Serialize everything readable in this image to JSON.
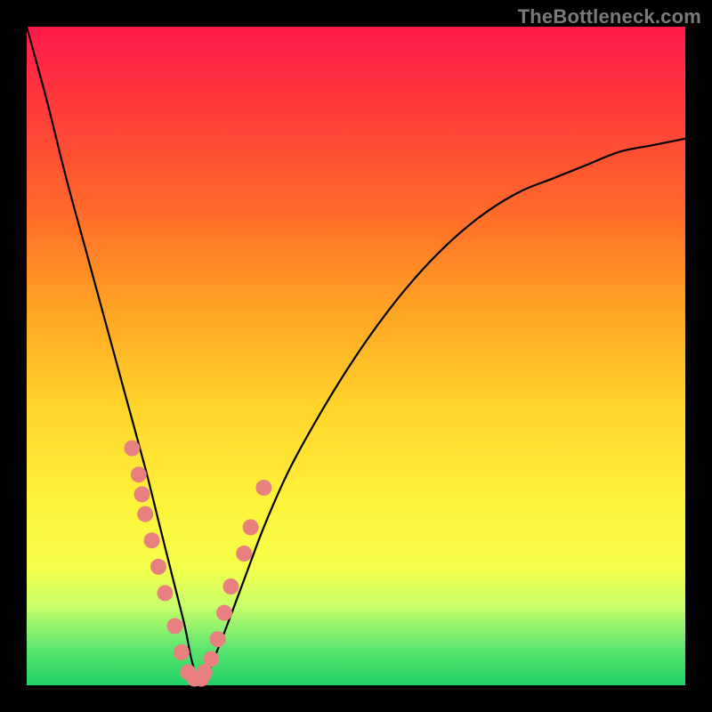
{
  "watermark": "TheBottleneck.com",
  "colors": {
    "background": "#000000",
    "gradient_top": "#ff1a4b",
    "gradient_bottom": "#1fd067",
    "curve": "#000000",
    "dot": "#e98080"
  },
  "chart_data": {
    "type": "line",
    "title": "",
    "xlabel": "",
    "ylabel": "",
    "xlim": [
      0,
      100
    ],
    "ylim": [
      0,
      100
    ],
    "x": [
      0,
      3,
      6,
      9,
      12,
      15,
      18,
      20,
      22,
      24,
      25,
      26,
      27,
      28,
      30,
      33,
      36,
      40,
      45,
      50,
      55,
      60,
      65,
      70,
      75,
      80,
      85,
      90,
      95,
      100
    ],
    "values": [
      100,
      89,
      77,
      66,
      55,
      44,
      33,
      25,
      17,
      9,
      4,
      1,
      1,
      3,
      8,
      16,
      24,
      33,
      42,
      50,
      57,
      63,
      68,
      72,
      75,
      77,
      79,
      81,
      82,
      83
    ],
    "markers": {
      "x": [
        16,
        17,
        17.5,
        18,
        19,
        20,
        21,
        22.5,
        23.5,
        24.5,
        25.5,
        26.5,
        27,
        28,
        29,
        30,
        31,
        33,
        34,
        36
      ],
      "values": [
        36,
        32,
        29,
        26,
        22,
        18,
        14,
        9,
        5,
        2,
        1,
        1,
        2,
        4,
        7,
        11,
        15,
        20,
        24,
        30
      ]
    }
  }
}
